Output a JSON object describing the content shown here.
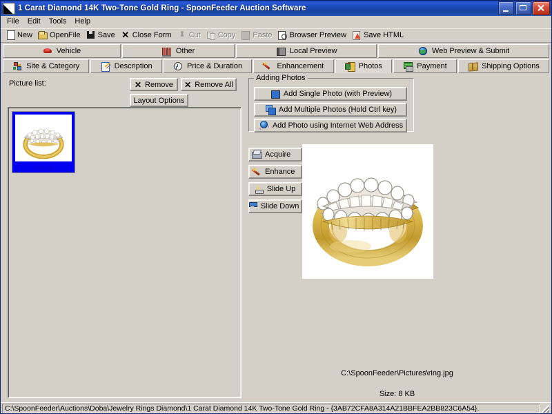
{
  "window": {
    "title": "1 Carat Diamond 14K Two-Tone Gold Ring - SpoonFeeder Auction Software",
    "icon": "app-icon",
    "minimize_label": "Minimize",
    "maximize_label": "Maximize",
    "close_label": "Close"
  },
  "menu": {
    "items": [
      {
        "label": "File"
      },
      {
        "label": "Edit"
      },
      {
        "label": "Tools"
      },
      {
        "label": "Help"
      }
    ]
  },
  "toolbar": {
    "items": [
      {
        "label": "New",
        "icon": "new-document-icon",
        "enabled": true
      },
      {
        "label": "OpenFile",
        "icon": "open-folder-icon",
        "enabled": true
      },
      {
        "label": "Save",
        "icon": "floppy-disk-icon",
        "enabled": true
      },
      {
        "label": "Close Form",
        "icon": "close-x-icon",
        "enabled": true
      },
      {
        "label": "Cut",
        "icon": "scissors-icon",
        "enabled": false
      },
      {
        "label": "Copy",
        "icon": "copy-icon",
        "enabled": false
      },
      {
        "label": "Paste",
        "icon": "clipboard-icon",
        "enabled": false
      },
      {
        "label": "Browser Preview",
        "icon": "page-magnifier-icon",
        "enabled": true
      },
      {
        "label": "Save HTML",
        "icon": "save-html-icon",
        "enabled": true
      }
    ]
  },
  "tabs_row1": [
    {
      "label": "Vehicle",
      "icon": "car-icon",
      "active": false
    },
    {
      "label": "Other",
      "icon": "barcode-icon",
      "active": false
    },
    {
      "label": "Local Preview",
      "icon": "book-icon",
      "active": false
    },
    {
      "label": "Web Preview & Submit",
      "icon": "globe-icon",
      "active": false
    }
  ],
  "tabs_row2": [
    {
      "label": "Site & Category",
      "icon": "sitemap-icon",
      "active": false
    },
    {
      "label": "Description",
      "icon": "notepad-pencil-icon",
      "active": false
    },
    {
      "label": "Price & Duration",
      "icon": "clock-icon",
      "active": false
    },
    {
      "label": "Enhancement",
      "icon": "magic-wand-icon",
      "active": false
    },
    {
      "label": "Photos",
      "icon": "film-roll-icon",
      "active": true
    },
    {
      "label": "Payment",
      "icon": "money-card-icon",
      "active": false
    },
    {
      "label": "Shipping Options",
      "icon": "package-box-icon",
      "active": false
    }
  ],
  "picture_list": {
    "label": "Picture list:",
    "remove_button": "Remove",
    "remove_all_button": "Remove All",
    "layout_options_button": "Layout Options",
    "remove_icon": "x-icon",
    "remove_all_icon": "x-icon",
    "items": [
      {
        "filename": "ring.jpg",
        "selected": true,
        "thumbnail": "gold-diamond-ring"
      }
    ]
  },
  "adding_photos": {
    "group_title": "Adding Photos",
    "buttons": [
      {
        "label": "Add Single Photo (with Preview)",
        "icon": "single-photo-icon"
      },
      {
        "label": "Add Multiple Photos (Hold Ctrl key)",
        "icon": "multiple-photos-icon"
      },
      {
        "label": "Add Photo using Internet Web Address",
        "icon": "internet-globe-icon"
      }
    ]
  },
  "side_buttons": [
    {
      "label": "Acquire",
      "icon": "scanner-icon"
    },
    {
      "label": "Enhance",
      "icon": "magic-wand-icon"
    },
    {
      "label": "Slide Up",
      "icon": "arrow-up-icon"
    },
    {
      "label": "Slide Down",
      "icon": "arrow-down-icon"
    }
  ],
  "preview": {
    "image_alt": "gold-diamond-ring",
    "path": "C:\\SpoonFeeder\\Pictures\\ring.jpg",
    "size": "Size: 8 KB"
  },
  "statusbar": {
    "text": "C:\\SpoonFeeder\\Auctions\\Doba\\Jewelry Rings Diamond\\1 Carat Diamond 14K Two-Tone Gold Ring - {3AB72CFA8A314A21BBFEA2BB823C6A54}."
  },
  "colors": {
    "face": "#d4d0c8",
    "titlebar": "#1c48b8",
    "selection": "#0000ee",
    "close_button": "#c9402a",
    "gold": "#d4af37"
  }
}
